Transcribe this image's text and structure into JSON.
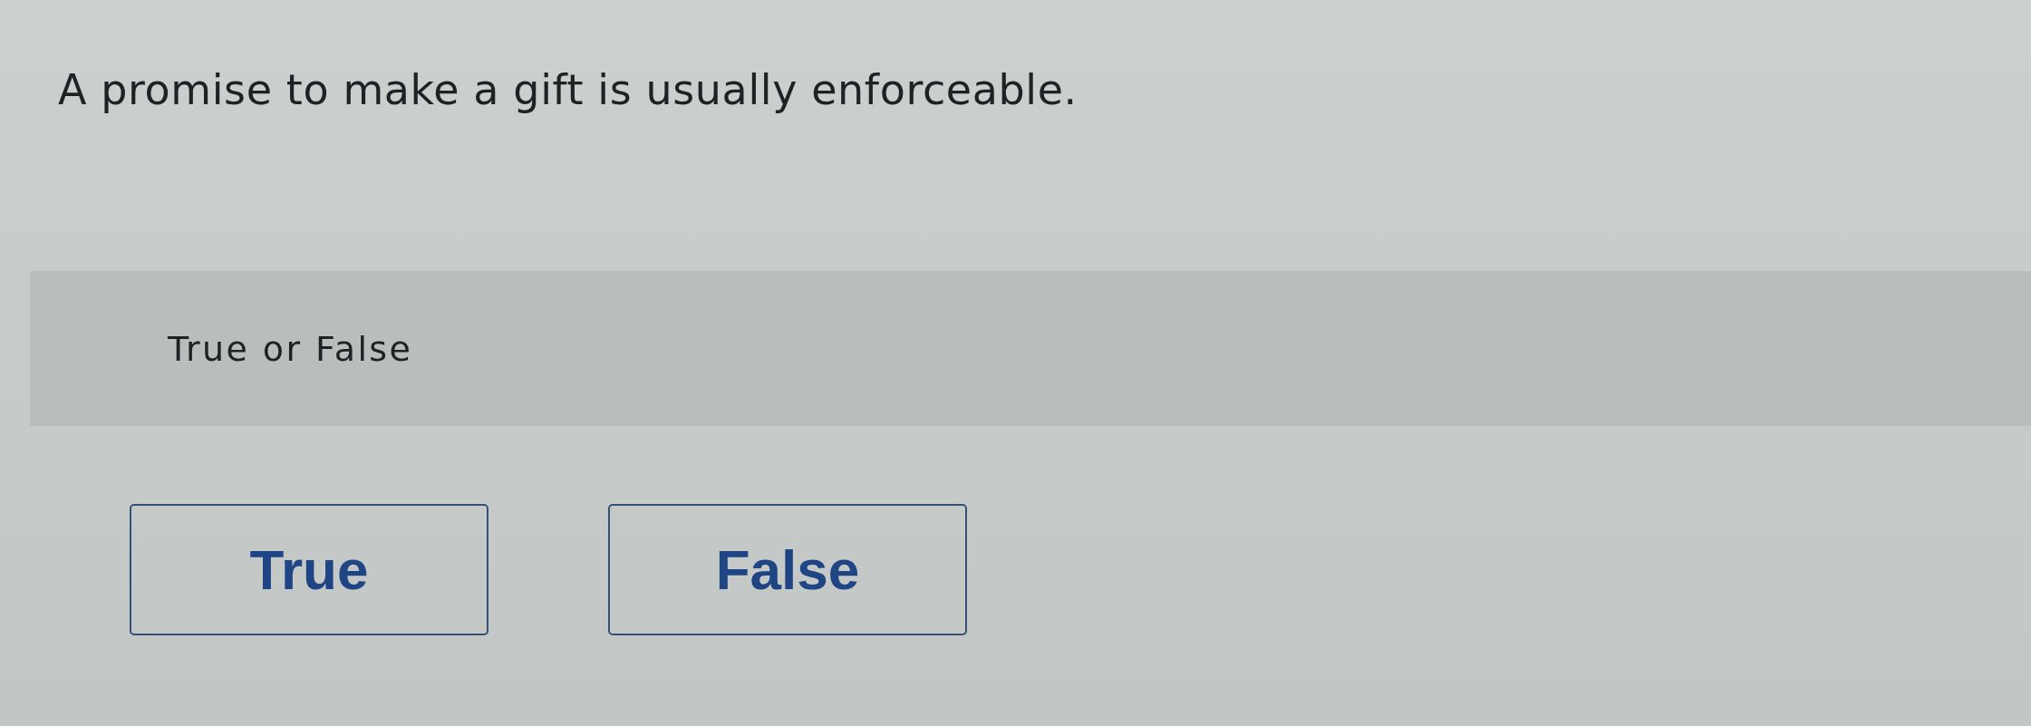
{
  "question": {
    "text": "A promise to make a gift is usually enforceable."
  },
  "answer_panel": {
    "prompt": "True or False"
  },
  "options": [
    {
      "label": "True",
      "selected": false
    },
    {
      "label": "False",
      "selected": false
    }
  ]
}
